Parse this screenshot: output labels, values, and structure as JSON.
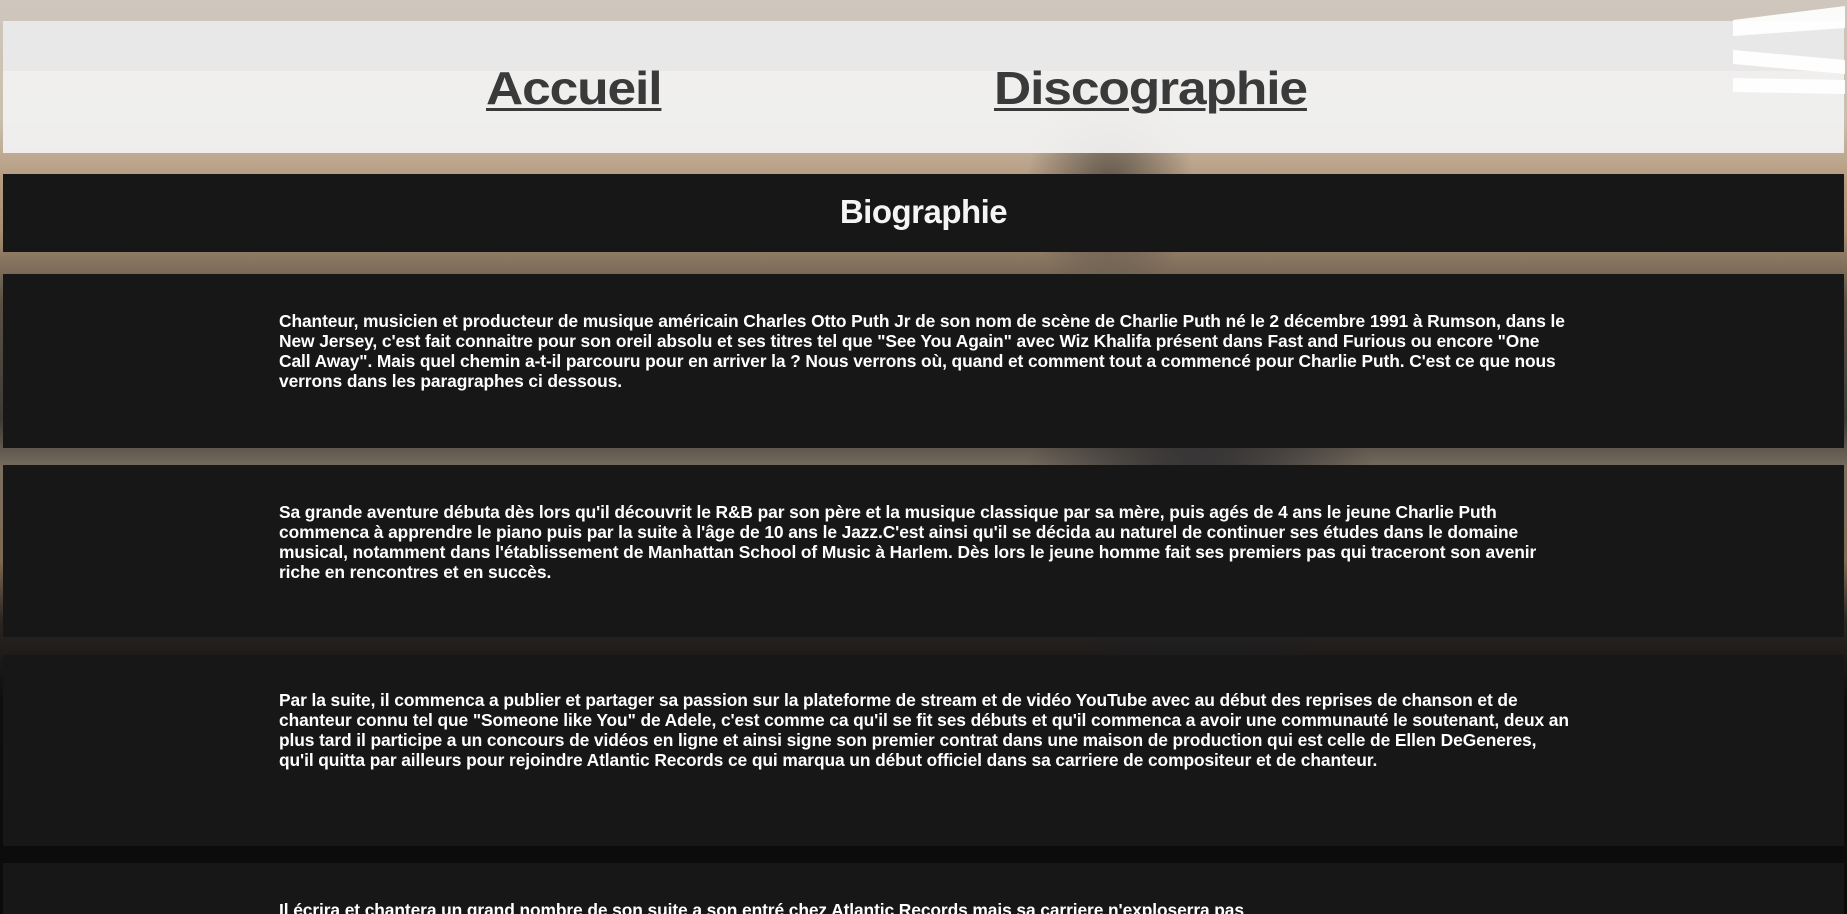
{
  "nav": {
    "links": [
      {
        "label": "Accueil"
      },
      {
        "label": "Discographie"
      }
    ]
  },
  "page": {
    "title": "Biographie"
  },
  "sections": [
    {
      "text": "Chanteur, musicien et producteur de musique américain Charles Otto Puth Jr de son nom de scène de Charlie Puth né le 2 décembre 1991 à Rumson, dans le New Jersey, c'est fait connaitre pour son oreil absolu et ses titres tel que \"See You Again\" avec Wiz Khalifa présent dans Fast and Furious ou encore \"One Call Away\". Mais quel chemin a-t-il parcouru pour en arriver la ? Nous verrons où, quand et comment tout a commencé pour Charlie Puth. C'est ce que nous verrons dans les paragraphes ci dessous."
    },
    {
      "text": "Sa grande aventure débuta dès lors qu'il découvrit le R&B par son père et la musique classique par sa mère, puis agés de 4 ans le jeune Charlie Puth commenca à apprendre le piano puis par la suite à l'âge de 10 ans le Jazz.C'est ainsi qu'il se décida au naturel de continuer ses études dans le domaine musical, notamment dans l'établissement de Manhattan School of Music à Harlem. Dès lors le jeune homme fait ses premiers pas qui traceront son avenir riche en rencontres et en succès."
    },
    {
      "text": "Par la suite, il commenca a publier et partager sa passion sur la plateforme de stream et de vidéo YouTube avec au début des reprises de chanson et de chanteur connu tel que \"Someone like You\" de Adele, c'est comme ca qu'il se fit ses débuts et qu'il commenca a avoir une communauté le soutenant, deux an plus tard il participe a un concours de vidéos en ligne et ainsi signe son premier contrat dans une maison de production qui est celle de Ellen DeGeneres, qu'il quitta par ailleurs pour rejoindre Atlantic Records ce qui marqua un début officiel dans sa carriere de compositeur et de chanteur."
    },
    {
      "text": "Il écrira et chantera un grand nombre de son suite a son entré chez Atlantic Records mais sa carriere n'exploserra pas"
    }
  ],
  "colors": {
    "nav_bg": "#f2f2f2",
    "link": "#3a3a3a",
    "panel_bg": "#171717",
    "text": "#ffffff"
  },
  "icons": {
    "logo": "stacked-white-bars-logo"
  }
}
